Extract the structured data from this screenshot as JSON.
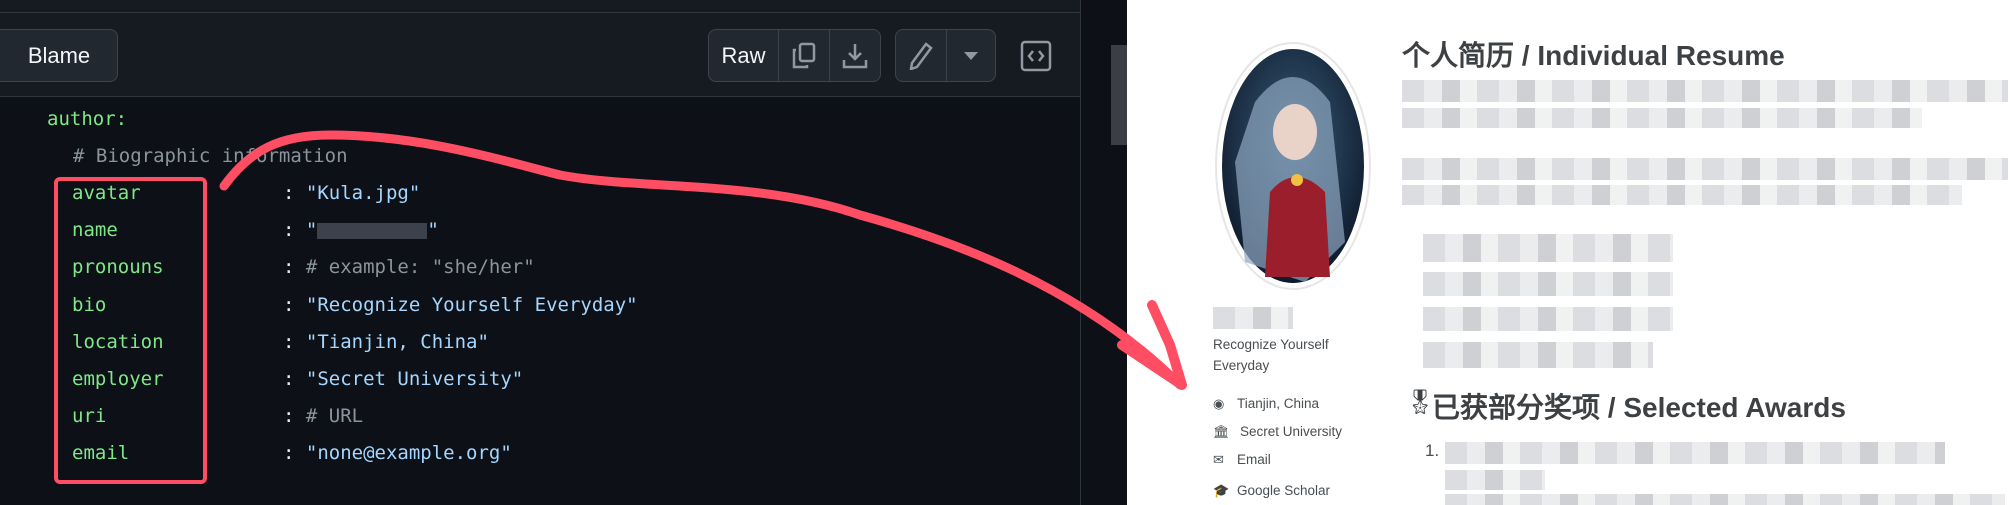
{
  "toolbar": {
    "blame_label": "Blame",
    "raw_label": "Raw"
  },
  "code": {
    "author": "author:",
    "comment": "# Biographic information",
    "fields": [
      {
        "key": "avatar",
        "value": "\"Kula.jpg\"",
        "type": "string"
      },
      {
        "key": "name",
        "value": "\"\"",
        "type": "blurred"
      },
      {
        "key": "pronouns",
        "value": "# example: \"she/her\"",
        "type": "comment"
      },
      {
        "key": "bio",
        "value": "\"Recognize Yourself Everyday\"",
        "type": "string"
      },
      {
        "key": "location",
        "value": "\"Tianjin, China\"",
        "type": "string"
      },
      {
        "key": "employer",
        "value": "\"Secret University\"",
        "type": "string"
      },
      {
        "key": "uri",
        "value": "# URL",
        "type": "comment"
      },
      {
        "key": "email",
        "value": "\"none@example.org\"",
        "type": "string"
      }
    ]
  },
  "profile": {
    "bio_line1": "Recognize Yourself",
    "bio_line2": "Everyday",
    "links": [
      {
        "icon": "map-marker-icon",
        "label": "Tianjin, China"
      },
      {
        "icon": "university-icon",
        "label": "Secret University"
      },
      {
        "icon": "envelope-icon",
        "label": "Email"
      },
      {
        "icon": "google-scholar-icon",
        "label": "Google Scholar"
      }
    ]
  },
  "content": {
    "heading1": "个人简历 / Individual Resume",
    "heading2": "已获部分奖项 / Selected Awards",
    "list_number": "1."
  },
  "colors": {
    "annotation": "#ff4d63",
    "key": "#7ee787",
    "string": "#a5d6ff"
  }
}
